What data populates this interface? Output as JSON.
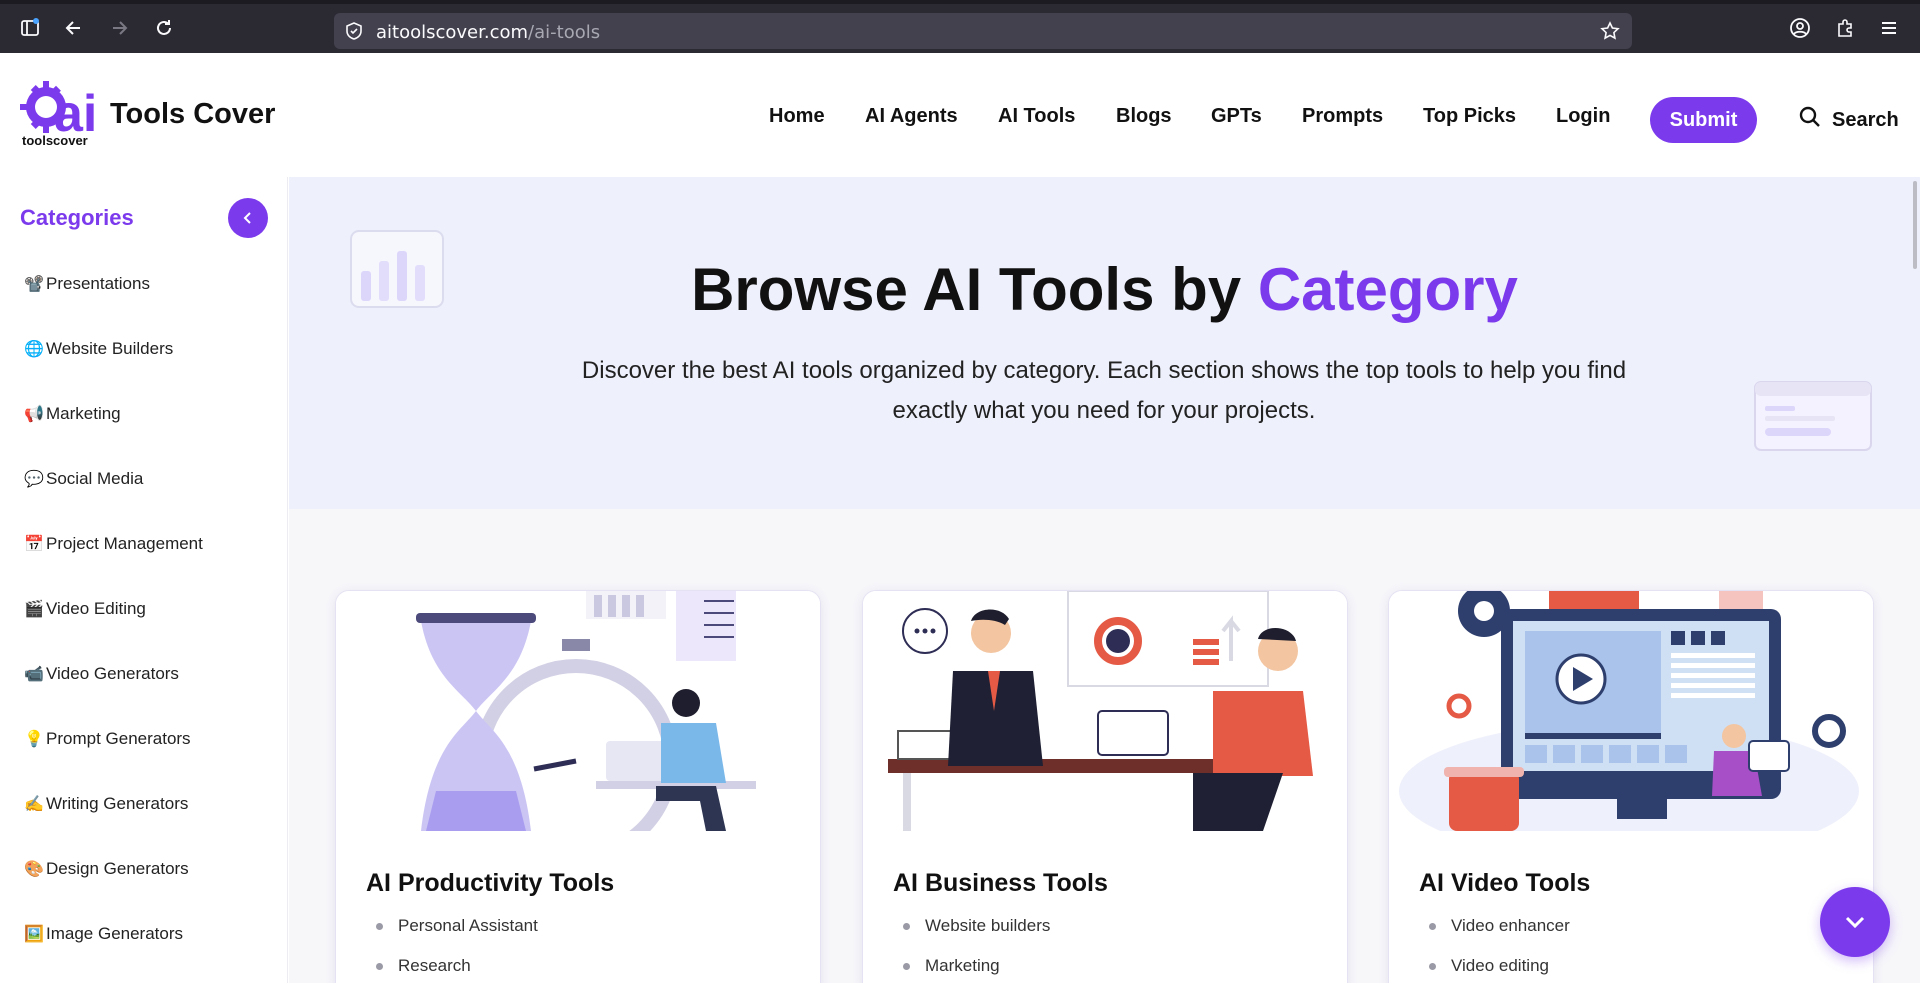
{
  "browser": {
    "url_host": "aitoolscover.com",
    "url_path": "/ai-tools"
  },
  "header": {
    "brand": "Tools Cover",
    "logo_sub": "toolscover",
    "logo_letters": "ai",
    "nav": [
      "Home",
      "AI Agents",
      "AI Tools",
      "Blogs",
      "GPTs",
      "Prompts",
      "Top Picks",
      "Login"
    ],
    "submit_label": "Submit",
    "search_label": "Search"
  },
  "sidebar": {
    "title": "Categories",
    "items": [
      {
        "emoji": "📽️",
        "label": "Presentations"
      },
      {
        "emoji": "🌐",
        "label": "Website Builders"
      },
      {
        "emoji": "📢",
        "label": "Marketing"
      },
      {
        "emoji": "💬",
        "label": "Social Media"
      },
      {
        "emoji": "📅",
        "label": "Project Management"
      },
      {
        "emoji": "🎬",
        "label": "Video Editing"
      },
      {
        "emoji": "📹",
        "label": "Video Generators"
      },
      {
        "emoji": "💡",
        "label": "Prompt Generators"
      },
      {
        "emoji": "✍️",
        "label": "Writing Generators"
      },
      {
        "emoji": "🎨",
        "label": "Design Generators"
      },
      {
        "emoji": "🖼️",
        "label": "Image Generators"
      }
    ]
  },
  "hero": {
    "title_main": "Browse AI Tools by ",
    "title_accent": "Category",
    "description": "Discover the best AI tools organized by category. Each section shows the top tools to help you find exactly what you need for your projects."
  },
  "cards": [
    {
      "title": "AI Productivity Tools",
      "items": [
        "Personal Assistant",
        "Research"
      ]
    },
    {
      "title": "AI Business Tools",
      "items": [
        "Website builders",
        "Marketing"
      ]
    },
    {
      "title": "AI Video Tools",
      "items": [
        "Video enhancer",
        "Video editing"
      ]
    }
  ],
  "colors": {
    "accent": "#7c3aed",
    "hero_bg": "#eef0fb",
    "browser_bg": "#2b2a33"
  }
}
